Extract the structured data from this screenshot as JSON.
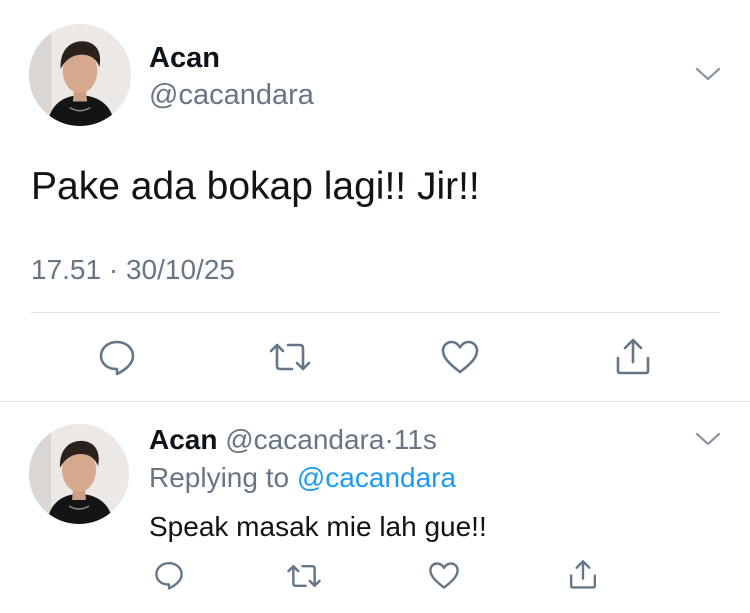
{
  "tweet": {
    "author_name": "Acan",
    "handle": "@cacandara",
    "text": "Pake ada bokap lagi!! Jir!!",
    "time": "17.51",
    "separator": "·",
    "date": "30/10/25",
    "menu_icon": "chevron-down-icon",
    "actions": [
      {
        "name": "reply",
        "icon": "reply-icon"
      },
      {
        "name": "retweet",
        "icon": "retweet-icon"
      },
      {
        "name": "like",
        "icon": "heart-icon"
      },
      {
        "name": "share",
        "icon": "share-icon"
      }
    ]
  },
  "reply": {
    "author_name": "Acan",
    "handle": "@cacandara",
    "separator": "·",
    "age": "11s",
    "replying_prefix": "Replying to",
    "replying_to": "@cacandara",
    "text": "Speak masak mie lah gue!!",
    "menu_icon": "chevron-down-icon"
  },
  "colors": {
    "text": "#0f1419",
    "muted": "#687684",
    "link": "#1d9bf0",
    "divider": "#e1e4e8"
  }
}
